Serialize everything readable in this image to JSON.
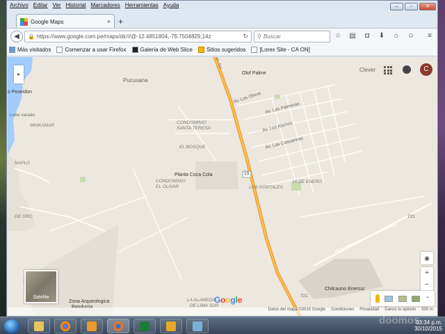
{
  "menubar": {
    "items": [
      "Archivo",
      "Editar",
      "Ver",
      "Historial",
      "Marcadores",
      "Herramientas",
      "Ayuda"
    ]
  },
  "tab": {
    "title": "Google Maps",
    "close": "×",
    "new_tab": "+"
  },
  "navbar": {
    "url": "https://www.google.com.pe/maps/dir///@-12.4851804,-76.7504829,14z",
    "search_placeholder": "Buscar"
  },
  "bookmarks": [
    "Más visitados",
    "Comenzar a usar Firefox",
    "Galería de Web Slice",
    "Sitios sugeridos",
    "[Lorex Site - CA ON]"
  ],
  "map": {
    "clever": "Clever",
    "avatar_letter": "C",
    "satellite_label": "Satelite",
    "logo": {
      "G": "G",
      "o1": "o",
      "o2": "o",
      "g": "g",
      "l": "l",
      "e": "e"
    },
    "labels": {
      "pucusana": "Pucusana",
      "olof_palme": "Olof Palme",
      "poseidon": "o Poseidon",
      "lobo_varado": "Lobo varado",
      "minkamar": "MINKAMAR",
      "condominio_santa_teresa_1": "CONDOMINIO",
      "condominio_santa_teresa_2": "SANTA TERESA",
      "el_bosque": "EL BOSQUE",
      "av_los_olivos": "Av. Los Olivos",
      "av_las_palmeras": "Av. Las Palmeras",
      "av_los_alamos": "Av. Los Alamos",
      "av_las_casuarinas": "Av. Las Casuarinas",
      "planta_coca_cola": "Planta Coca Cola",
      "condominio_el_olivar_1": "CONDOMINIO",
      "condominio_el_olivar_2": "EL OLIVAR",
      "los_portales": "LOS PORTALES",
      "enero": "16 DE ENERO",
      "naplo": "NAPLO",
      "de_oro": "DE ORO",
      "lima_sur_1": "LA ALAMEDA",
      "lima_sur_2": "DE LIMA SUR",
      "chilcauno": "Chilcauno Enersur",
      "zona_arq_1": "Zona Arqueologica",
      "zona_arq_2": "Bandurria",
      "route_1": "1S",
      "route_721": "721",
      "route_721b": "721",
      "pan_sur": "Pan. Sur"
    },
    "footer": [
      "Datos del mapa ©2015 Google",
      "Condiciones",
      "Privacidad",
      "Danos tu opinión",
      "500 m"
    ]
  },
  "taskbar": {
    "time": "03:34 p.m.",
    "date": "30/10/2015",
    "watermark": "doomos"
  },
  "colors": {
    "highway": "#f0a637",
    "sea": "#a3ccff",
    "land": "#ede8df",
    "park": "#c9dcb0"
  }
}
